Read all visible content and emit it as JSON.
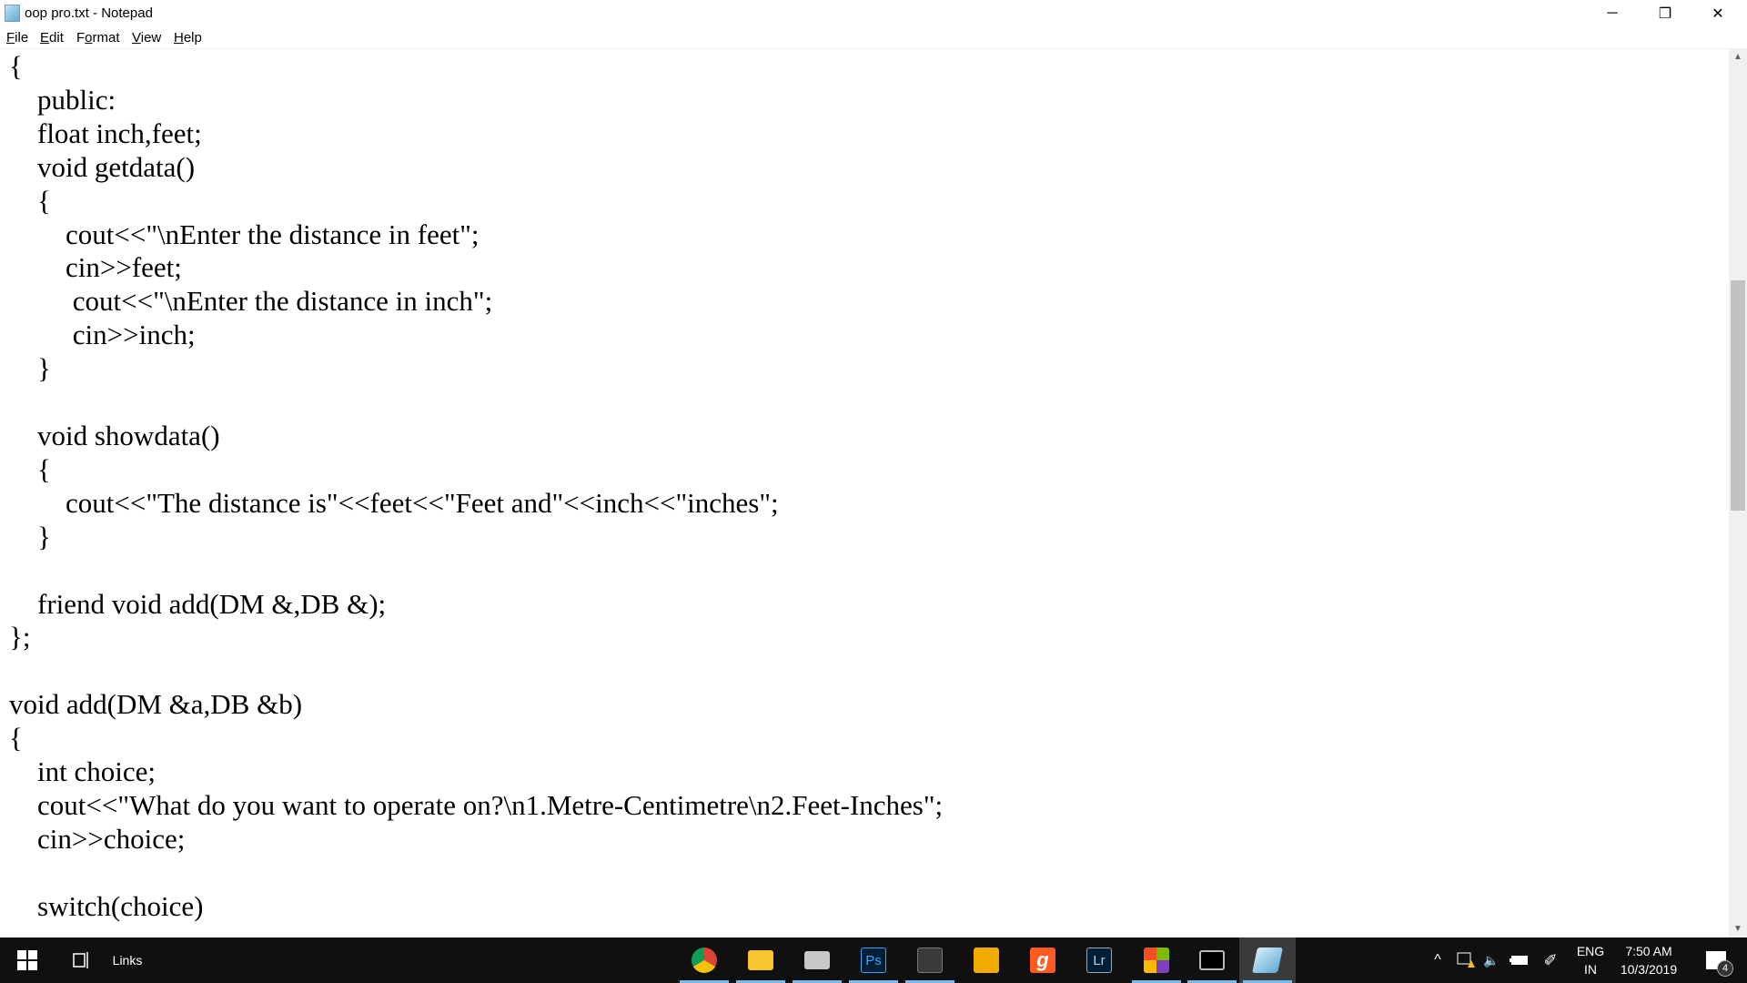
{
  "window": {
    "title": "oop pro.txt - Notepad",
    "minimize": "─",
    "restore": "❐",
    "close": "✕"
  },
  "menu": [
    {
      "first": "F",
      "rest": "ile"
    },
    {
      "first": "E",
      "rest": "dit"
    },
    {
      "first": "F",
      "rest": "ormat",
      "pre": "",
      "alt": "Format"
    },
    {
      "first": "V",
      "rest": "iew"
    },
    {
      "first": "H",
      "rest": "elp"
    }
  ],
  "code": "{\n    public:\n    float inch,feet;\n    void getdata()\n    {\n        cout<<\"\\nEnter the distance in feet\";\n        cin>>feet;\n         cout<<\"\\nEnter the distance in inch\";\n         cin>>inch;\n    }\n\n    void showdata()\n    {\n        cout<<\"The distance is\"<<feet<<\"Feet and\"<<inch<<\"inches\";\n    }\n\n    friend void add(DM &,DB &);\n};\n\nvoid add(DM &a,DB &b)\n{\n    int choice;\n    cout<<\"What do you want to operate on?\\n1.Metre-Centimetre\\n2.Feet-Inches\";\n    cin>>choice;\n\n    switch(choice)",
  "taskbar": {
    "links": "Links",
    "apps": [
      {
        "name": "chrome",
        "color": "#db4437"
      },
      {
        "name": "file-explorer",
        "color": "#f8c531"
      },
      {
        "name": "printer",
        "color": "#c8c8c8"
      },
      {
        "name": "photoshop",
        "color": "#001e36",
        "label": "Ps"
      },
      {
        "name": "app-dark",
        "color": "#3a3a3a"
      },
      {
        "name": "app-yellow",
        "color": "#f2a900"
      },
      {
        "name": "app-g",
        "color": "#ff5a1f",
        "label": "g"
      },
      {
        "name": "lightroom",
        "color": "#001e36",
        "label": "Lr"
      },
      {
        "name": "office-grid",
        "color": "#7fba00"
      },
      {
        "name": "command-prompt",
        "color": "#000000"
      },
      {
        "name": "notepad",
        "color": "#7fc4e8"
      }
    ],
    "lang1": "ENG",
    "lang2": "IN",
    "time": "7:50 AM",
    "date": "10/3/2019",
    "notifications": "4"
  }
}
